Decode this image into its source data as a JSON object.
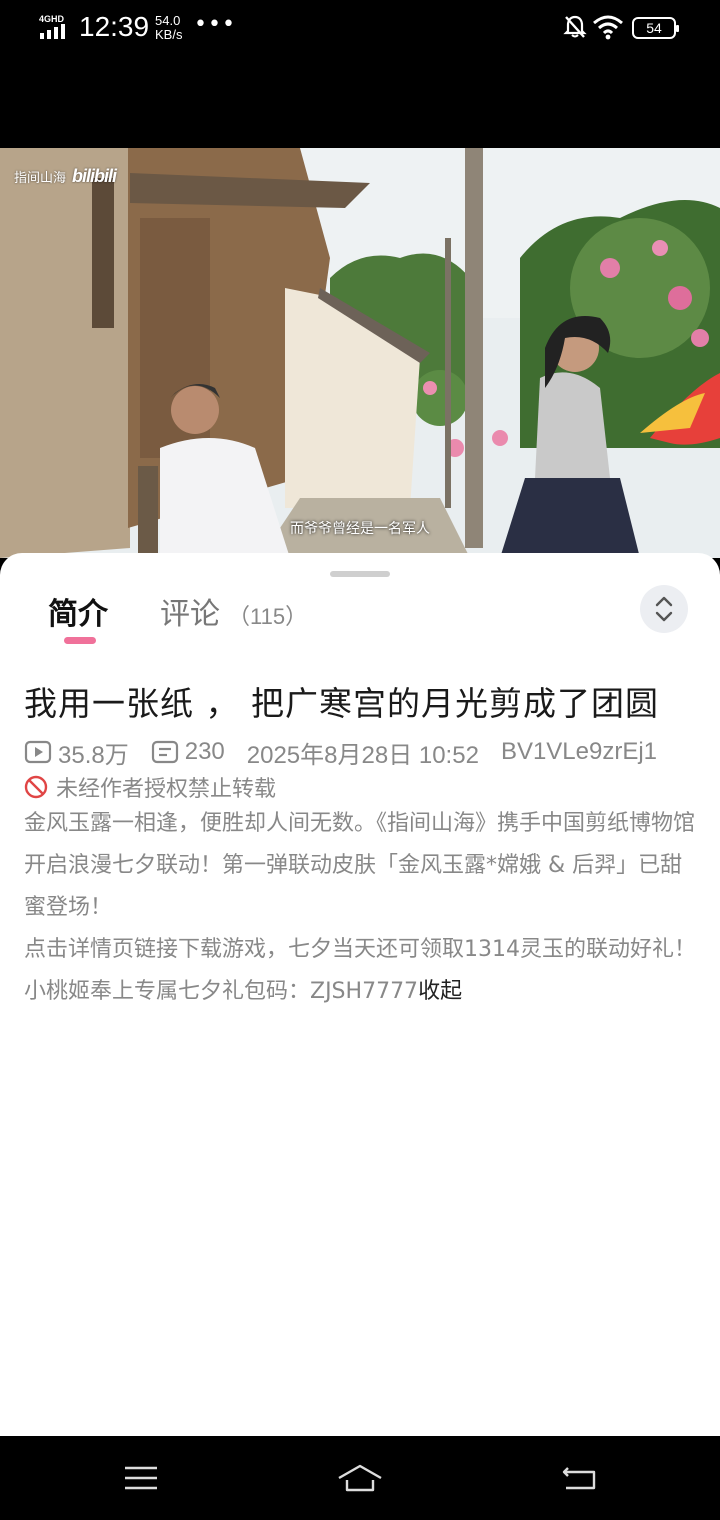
{
  "status_bar": {
    "network": "4GHD",
    "time": "12:39",
    "speed_value": "54.0",
    "speed_unit": "KB/s",
    "more": "•••",
    "battery": "54"
  },
  "video": {
    "watermark_channel": "指间山海",
    "watermark_logo": "bilibili",
    "subtitle": "而爷爷曾经是一名军人"
  },
  "tabs": {
    "intro": "简介",
    "comments": "评论",
    "comments_count": "（115）",
    "active": "intro",
    "accent_color": "#f0719a"
  },
  "detail": {
    "title": "我用一张纸 ， 把广寒宫的月光剪成了团圆",
    "views": "35.8万",
    "danmaku": "230",
    "date": "2025年8月28日 10:52",
    "bvid": "BV1VLe9zrEj1",
    "notice": "未经作者授权禁止转载",
    "description": [
      "金风玉露一相逢，便胜却人间无数。《指间山海》携手中国剪纸博物馆开启浪漫七夕联动！第一弹联动皮肤「金风玉露*嫦娥 & 后羿」已甜蜜登场！",
      "点击详情页链接下载游戏，七夕当天还可领取1314灵玉的联动好礼！",
      "小桃姬奉上专属七夕礼包码：ZJSH7777"
    ],
    "collapse_label": "收起"
  },
  "nav": {
    "icons": [
      "menu-icon",
      "home-icon",
      "back-icon"
    ]
  }
}
